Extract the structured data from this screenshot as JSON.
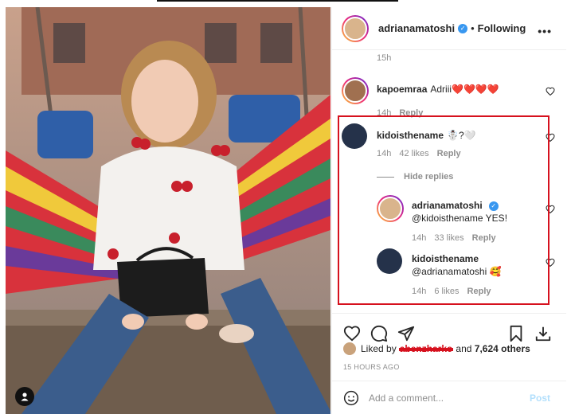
{
  "post": {
    "username": "adrianamatoshi",
    "separator": "•",
    "follow_state": "Following",
    "more_icon": "more-horizontal-icon",
    "caption_time": "15h"
  },
  "comments": [
    {
      "username": "kapoemraa",
      "text": "Adriii❤️❤️❤️❤️",
      "time": "14h",
      "likes": "",
      "reply": "Reply"
    },
    {
      "username": "kidoisthename",
      "text": "☃️?🤍",
      "time": "14h",
      "likes": "42 likes",
      "reply": "Reply"
    }
  ],
  "hide_replies": "Hide replies",
  "replies": [
    {
      "username": "adrianamatoshi",
      "text": "@kidoisthename YES!",
      "time": "14h",
      "likes": "33 likes",
      "reply": "Reply"
    },
    {
      "username": "kidoisthename",
      "text": "@adrianamatoshi 🥰",
      "time": "14h",
      "likes": "6 likes",
      "reply": "Reply"
    }
  ],
  "likes": {
    "prefix": "Liked by",
    "redacted_user": "abenzharko",
    "connector": "and",
    "others": "7,624 others"
  },
  "timestamp": "15 HOURS AGO",
  "add_comment": {
    "placeholder": "Add a comment...",
    "post_label": "Post"
  },
  "colors": {
    "verified": "#3897f0",
    "highlight": "#d6111e",
    "post_button": "#b2dffc",
    "muted_text": "#8e8e8e"
  }
}
